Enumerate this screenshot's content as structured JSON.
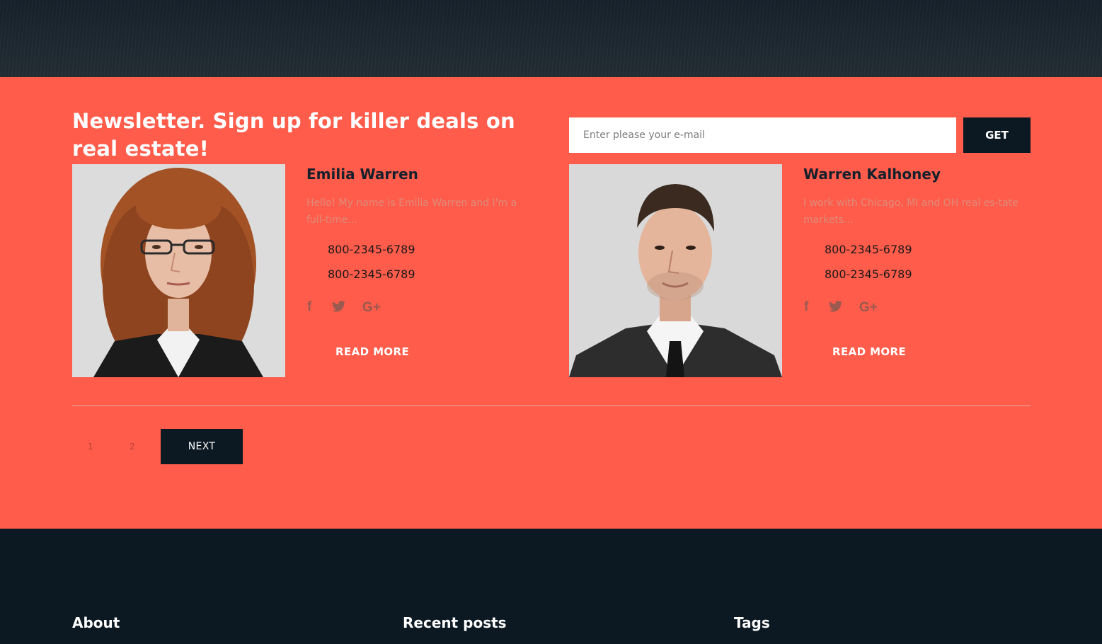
{
  "newsletter": {
    "title": "Newsletter. Sign up for killer deals on real estate!",
    "email_placeholder": "Enter please your e-mail",
    "submit_label": "GET"
  },
  "agents": [
    {
      "name": "Emilia Warren",
      "bio": "Hello! My name is Emilia Warren and I'm a full-time...",
      "phone_1": "800-2345-6789",
      "phone_2": "800-2345-6789",
      "social": {
        "facebook": "f",
        "twitter": "t",
        "google_plus": "G+"
      },
      "read_more": "READ MORE"
    },
    {
      "name": "Warren Kalhoney",
      "bio": "I work with Chicago, MI and OH real es-tate markets...",
      "phone_1": "800-2345-6789",
      "phone_2": "800-2345-6789",
      "social": {
        "facebook": "f",
        "twitter": "t",
        "google_plus": "G+"
      },
      "read_more": "READ MORE"
    }
  ],
  "pagination": {
    "pages": [
      "1",
      "2"
    ],
    "next_label": "NEXT"
  },
  "footer": {
    "about_title": "About",
    "recent_posts_title": "Recent posts",
    "tags_title": "Tags"
  },
  "icons": {
    "phone": "phone-icon",
    "mobile": "mobile-icon",
    "facebook": "facebook-icon",
    "twitter": "twitter-icon",
    "google_plus": "google-plus-icon"
  },
  "colors": {
    "accent": "#ff5c4b",
    "dark": "#0c1923",
    "white": "#ffffff"
  }
}
